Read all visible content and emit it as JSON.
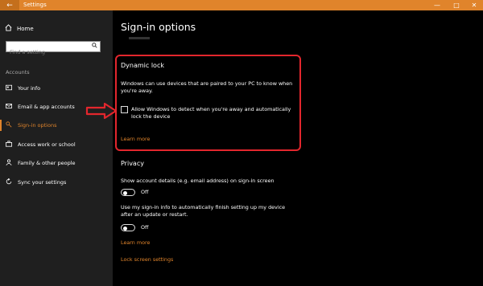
{
  "window": {
    "title": "Settings",
    "back_icon": "←",
    "minimize_icon": "—",
    "maximize_icon": "□",
    "close_icon": "✕",
    "accent": "#e0842b"
  },
  "sidebar": {
    "home_label": "Home",
    "search_placeholder": "Find a setting",
    "section_label": "Accounts",
    "items": [
      {
        "label": "Your info",
        "icon": "person-card-icon"
      },
      {
        "label": "Email & app accounts",
        "icon": "mail-icon"
      },
      {
        "label": "Sign-in options",
        "icon": "key-icon"
      },
      {
        "label": "Access work or school",
        "icon": "briefcase-icon"
      },
      {
        "label": "Family & other people",
        "icon": "people-icon"
      },
      {
        "label": "Sync your settings",
        "icon": "sync-icon"
      }
    ],
    "active_index": 2
  },
  "main": {
    "page_title": "Sign-in options",
    "dynamic_lock": {
      "heading": "Dynamic lock",
      "description_line1": "Windows can use devices that are paired to your PC to know when",
      "description_line2": "you're away.",
      "checkbox_line1": "Allow Windows to detect when you're away and automatically",
      "checkbox_line2": "lock the device",
      "checked": false,
      "learn_more": "Learn more"
    },
    "privacy": {
      "heading": "Privacy",
      "setting1": "Show account details (e.g. email address) on sign-in screen",
      "toggle1_state": "Off",
      "setting2_line1": "Use my sign-in info to automatically finish setting up my device",
      "setting2_line2": "after an update or restart.",
      "toggle2_state": "Off",
      "learn_more": "Learn more",
      "lock_screen_link": "Lock screen settings"
    }
  },
  "annotation": {
    "highlight_color": "#e3262d"
  }
}
